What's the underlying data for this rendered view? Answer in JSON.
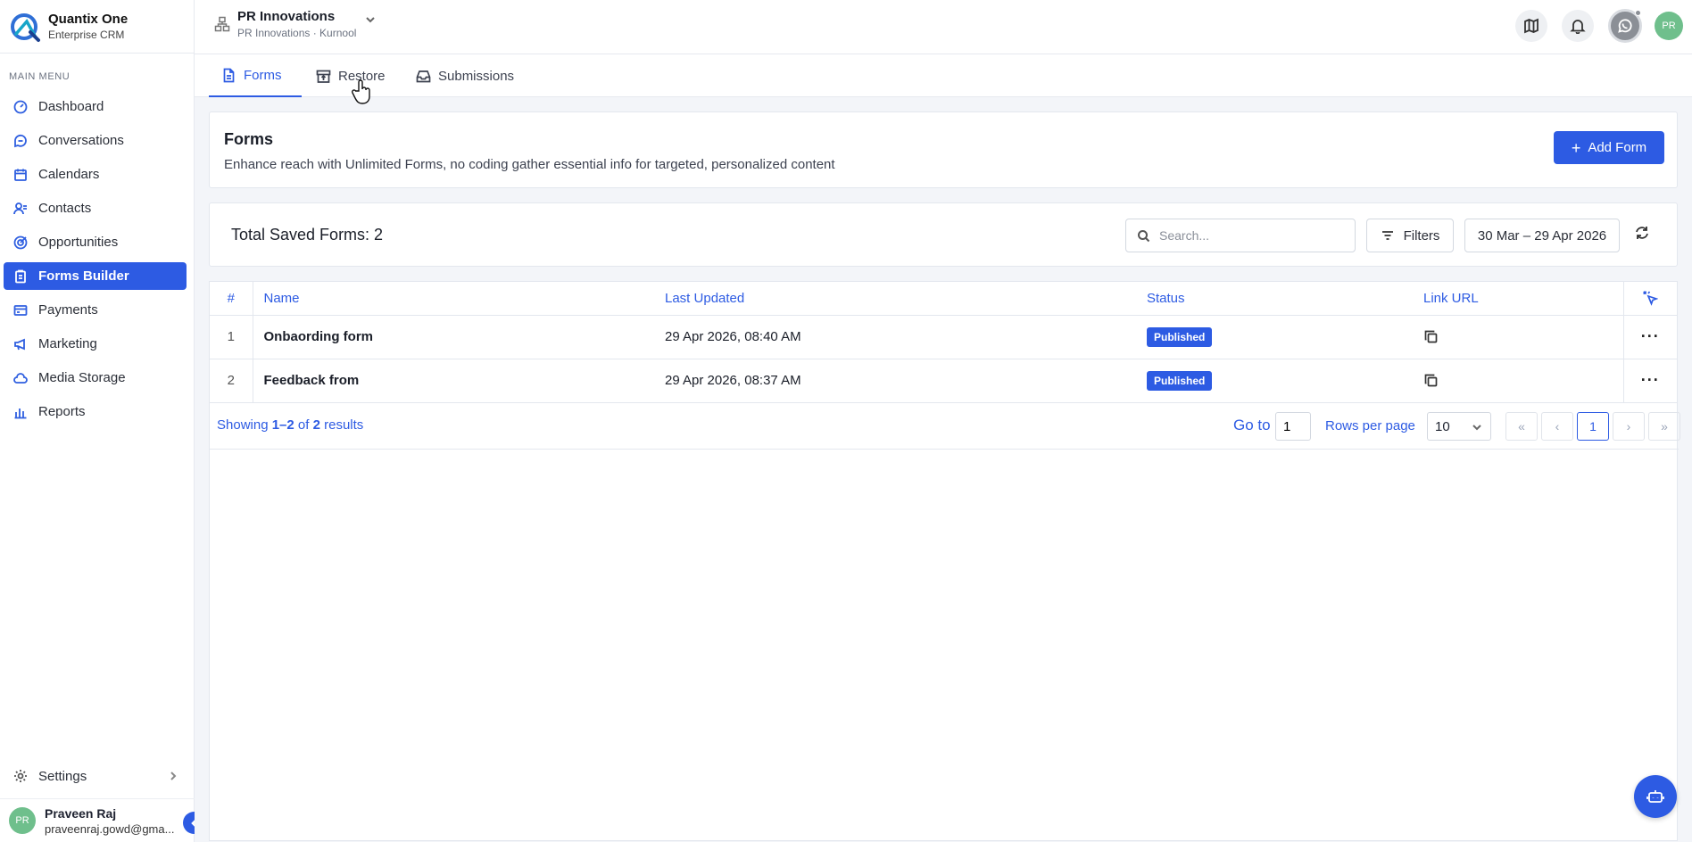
{
  "brand": {
    "name": "Quantix One",
    "subtitle": "Enterprise CRM"
  },
  "sidebar": {
    "section_title": "MAIN MENU",
    "items": [
      {
        "label": "Dashboard",
        "icon": "dashboard-icon"
      },
      {
        "label": "Conversations",
        "icon": "chat-icon"
      },
      {
        "label": "Calendars",
        "icon": "calendar-icon"
      },
      {
        "label": "Contacts",
        "icon": "contacts-icon"
      },
      {
        "label": "Opportunities",
        "icon": "target-icon"
      },
      {
        "label": "Forms Builder",
        "icon": "clipboard-icon",
        "active": true
      },
      {
        "label": "Payments",
        "icon": "credit-card-icon"
      },
      {
        "label": "Marketing",
        "icon": "megaphone-icon"
      },
      {
        "label": "Media Storage",
        "icon": "cloud-icon"
      },
      {
        "label": "Reports",
        "icon": "bar-chart-icon"
      }
    ],
    "settings_label": "Settings",
    "user": {
      "initials": "PR",
      "name": "Praveen Raj",
      "email": "praveenraj.gowd@gma..."
    }
  },
  "topbar": {
    "org_name": "PR Innovations",
    "org_sub": "PR Innovations · Kurnool",
    "avatar_initials": "PR"
  },
  "tabs": [
    {
      "label": "Forms",
      "active": true
    },
    {
      "label": "Restore"
    },
    {
      "label": "Submissions"
    }
  ],
  "header": {
    "title": "Forms",
    "description": "Enhance reach with Unlimited Forms, no coding gather essential info for targeted, personalized content",
    "add_button": "Add Form"
  },
  "toolbar": {
    "total_label": "Total Saved Forms: 2",
    "search_placeholder": "Search...",
    "filters_label": "Filters",
    "date_range": "30 Mar – 29 Apr 2026"
  },
  "table": {
    "columns": {
      "num": "#",
      "name": "Name",
      "updated": "Last Updated",
      "status": "Status",
      "link": "Link URL"
    },
    "rows": [
      {
        "num": "1",
        "name": "Onbaording form",
        "updated": "29 Apr 2026, 08:40 AM",
        "status": "Published"
      },
      {
        "num": "2",
        "name": "Feedback from",
        "updated": "29 Apr 2026, 08:37 AM",
        "status": "Published"
      }
    ]
  },
  "pagination": {
    "showing_prefix": "Showing",
    "range": "1–2",
    "of": "of",
    "total": "2",
    "results": "results",
    "goto_label": "Go to",
    "goto_value": "1",
    "rows_label": "Rows per page",
    "rows_value": "10",
    "current_page": "1"
  },
  "colors": {
    "accent": "#2d5be3",
    "avatar": "#6fbf8c",
    "background": "#f3f5f9"
  }
}
